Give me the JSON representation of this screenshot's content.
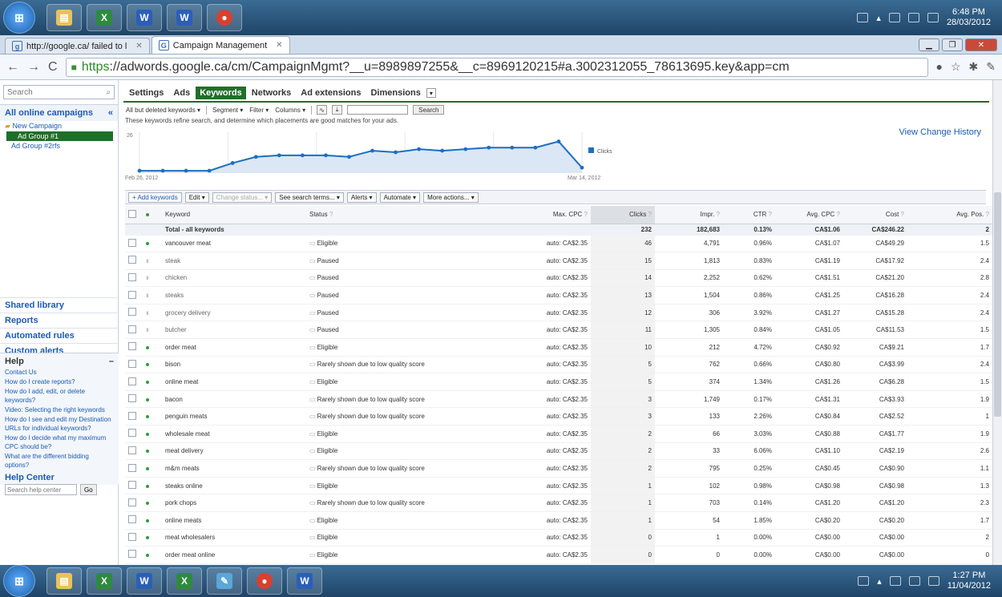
{
  "os": {
    "top_clock": {
      "time": "6:48 PM",
      "date": "28/03/2012"
    },
    "bottom_clock": {
      "time": "1:27 PM",
      "date": "11/04/2012"
    }
  },
  "browser": {
    "tabs": [
      {
        "label": "http://google.ca/ failed to l"
      },
      {
        "label": "Campaign Management"
      }
    ],
    "url_scheme": "https",
    "url_rest": "://adwords.google.ca/cm/CampaignMgmt?__u=8989897255&__c=8969120215#a.3002312055_78613695.key&app=cm"
  },
  "sidebar": {
    "search_placeholder": "Search",
    "all_campaigns": "All online campaigns",
    "campaign": "New Campaign",
    "ad_groups": [
      "Ad Group #1",
      "Ad Group #2rfs"
    ],
    "links": [
      "Shared library",
      "Reports",
      "Automated rules",
      "Custom alerts"
    ],
    "help": {
      "title": "Help",
      "links": [
        "Contact Us",
        "How do I create reports?",
        "How do I add, edit, or delete keywords?",
        "Video: Selecting the right keywords",
        "How do I see and edit my Destination URLs for individual keywords?",
        "How do I decide what my maximum CPC should be?",
        "What are the different bidding options?"
      ],
      "center_title": "Help Center",
      "center_placeholder": "Search help center",
      "go": "Go"
    }
  },
  "content_tabs": [
    "Settings",
    "Ads",
    "Keywords",
    "Networks",
    "Ad extensions",
    "Dimensions"
  ],
  "toolbar": {
    "filter": "All but deleted keywords",
    "segment": "Segment",
    "filter_btn": "Filter",
    "columns": "Columns",
    "search": "Search"
  },
  "note": "These keywords refine search, and determine which placements are good matches for your ads.",
  "view_history": "View Change History",
  "actions": [
    "+ Add keywords",
    "Edit",
    "Change status...",
    "See search terms...",
    "Alerts",
    "Automate",
    "More actions..."
  ],
  "chart_data": {
    "type": "area",
    "x_start_label": "Feb 26, 2012",
    "x_end_label": "Mar 14, 2012",
    "y_max_label": "26",
    "legend": "Clicks",
    "values": [
      1,
      1,
      1,
      1,
      6,
      10,
      11,
      11,
      11,
      10,
      14,
      13,
      15,
      14,
      15,
      16,
      16,
      16,
      20,
      3
    ]
  },
  "table": {
    "headers": [
      "Keyword",
      "Status",
      "Max. CPC",
      "Clicks",
      "Impr.",
      "CTR",
      "Avg. CPC",
      "Cost",
      "Avg. Pos."
    ],
    "total": [
      "Total - all keywords",
      "232",
      "182,683",
      "0.13%",
      "CA$1.06",
      "CA$246.22",
      "2"
    ],
    "rows": [
      {
        "kw": "vancouver meat",
        "state": "on",
        "status": "Eligible",
        "st": "e",
        "cpc": "auto: CA$2.35",
        "clicks": "46",
        "impr": "4,791",
        "ctr": "0.96%",
        "avg": "CA$1.07",
        "cost": "CA$49.29",
        "pos": "1.5"
      },
      {
        "kw": "steak",
        "state": "p",
        "status": "Paused",
        "st": "w",
        "cpc": "auto: CA$2.35",
        "clicks": "15",
        "impr": "1,813",
        "ctr": "0.83%",
        "avg": "CA$1.19",
        "cost": "CA$17.92",
        "pos": "2.4"
      },
      {
        "kw": "chicken",
        "state": "p",
        "status": "Paused",
        "st": "w",
        "cpc": "auto: CA$2.35",
        "clicks": "14",
        "impr": "2,252",
        "ctr": "0.62%",
        "avg": "CA$1.51",
        "cost": "CA$21.20",
        "pos": "2.8"
      },
      {
        "kw": "steaks",
        "state": "p",
        "status": "Paused",
        "st": "w",
        "cpc": "auto: CA$2.35",
        "clicks": "13",
        "impr": "1,504",
        "ctr": "0.86%",
        "avg": "CA$1.25",
        "cost": "CA$16.28",
        "pos": "2.4"
      },
      {
        "kw": "grocery delivery",
        "state": "p",
        "status": "Paused",
        "st": "w",
        "cpc": "auto: CA$2.35",
        "clicks": "12",
        "impr": "306",
        "ctr": "3.92%",
        "avg": "CA$1.27",
        "cost": "CA$15.28",
        "pos": "2.4"
      },
      {
        "kw": "butcher",
        "state": "p",
        "status": "Paused",
        "st": "w",
        "cpc": "auto: CA$2.35",
        "clicks": "11",
        "impr": "1,305",
        "ctr": "0.84%",
        "avg": "CA$1.05",
        "cost": "CA$11.53",
        "pos": "1.5"
      },
      {
        "kw": "order meat",
        "state": "on",
        "status": "Eligible",
        "st": "e",
        "cpc": "auto: CA$2.35",
        "clicks": "10",
        "impr": "212",
        "ctr": "4.72%",
        "avg": "CA$0.92",
        "cost": "CA$9.21",
        "pos": "1.7"
      },
      {
        "kw": "bison",
        "state": "on",
        "status": "Rarely shown due to low quality score",
        "st": "w",
        "cpc": "auto: CA$2.35",
        "clicks": "5",
        "impr": "762",
        "ctr": "0.66%",
        "avg": "CA$0.80",
        "cost": "CA$3.99",
        "pos": "2.4"
      },
      {
        "kw": "online meat",
        "state": "on",
        "status": "Eligible",
        "st": "e",
        "cpc": "auto: CA$2.35",
        "clicks": "5",
        "impr": "374",
        "ctr": "1.34%",
        "avg": "CA$1.26",
        "cost": "CA$6.28",
        "pos": "1.5"
      },
      {
        "kw": "bacon",
        "state": "on",
        "status": "Rarely shown due to low quality score",
        "st": "w",
        "cpc": "auto: CA$2.35",
        "clicks": "3",
        "impr": "1,749",
        "ctr": "0.17%",
        "avg": "CA$1.31",
        "cost": "CA$3.93",
        "pos": "1.9"
      },
      {
        "kw": "penguin meats",
        "state": "on",
        "status": "Rarely shown due to low quality score",
        "st": "w",
        "cpc": "auto: CA$2.35",
        "clicks": "3",
        "impr": "133",
        "ctr": "2.26%",
        "avg": "CA$0.84",
        "cost": "CA$2.52",
        "pos": "1"
      },
      {
        "kw": "wholesale meat",
        "state": "on",
        "status": "Eligible",
        "st": "e",
        "cpc": "auto: CA$2.35",
        "clicks": "2",
        "impr": "66",
        "ctr": "3.03%",
        "avg": "CA$0.88",
        "cost": "CA$1.77",
        "pos": "1.9"
      },
      {
        "kw": "meat delivery",
        "state": "on",
        "status": "Eligible",
        "st": "e",
        "cpc": "auto: CA$2.35",
        "clicks": "2",
        "impr": "33",
        "ctr": "6.06%",
        "avg": "CA$1.10",
        "cost": "CA$2.19",
        "pos": "2.6"
      },
      {
        "kw": "m&m meats",
        "state": "on",
        "status": "Rarely shown due to low quality score",
        "st": "w",
        "cpc": "auto: CA$2.35",
        "clicks": "2",
        "impr": "795",
        "ctr": "0.25%",
        "avg": "CA$0.45",
        "cost": "CA$0.90",
        "pos": "1.1"
      },
      {
        "kw": "steaks online",
        "state": "on",
        "status": "Eligible",
        "st": "e",
        "cpc": "auto: CA$2.35",
        "clicks": "1",
        "impr": "102",
        "ctr": "0.98%",
        "avg": "CA$0.98",
        "cost": "CA$0.98",
        "pos": "1.3"
      },
      {
        "kw": "pork chops",
        "state": "on",
        "status": "Rarely shown due to low quality score",
        "st": "w",
        "cpc": "auto: CA$2.35",
        "clicks": "1",
        "impr": "703",
        "ctr": "0.14%",
        "avg": "CA$1.20",
        "cost": "CA$1.20",
        "pos": "2.3"
      },
      {
        "kw": "online meats",
        "state": "on",
        "status": "Eligible",
        "st": "e",
        "cpc": "auto: CA$2.35",
        "clicks": "1",
        "impr": "54",
        "ctr": "1.85%",
        "avg": "CA$0.20",
        "cost": "CA$0.20",
        "pos": "1.7"
      },
      {
        "kw": "meat wholesalers",
        "state": "on",
        "status": "Eligible",
        "st": "e",
        "cpc": "auto: CA$2.35",
        "clicks": "0",
        "impr": "1",
        "ctr": "0.00%",
        "avg": "CA$0.00",
        "cost": "CA$0.00",
        "pos": "2"
      },
      {
        "kw": "order meat online",
        "state": "on",
        "status": "Eligible",
        "st": "e",
        "cpc": "auto: CA$2.35",
        "clicks": "0",
        "impr": "0",
        "ctr": "0.00%",
        "avg": "CA$0.00",
        "cost": "CA$0.00",
        "pos": "0"
      }
    ]
  }
}
